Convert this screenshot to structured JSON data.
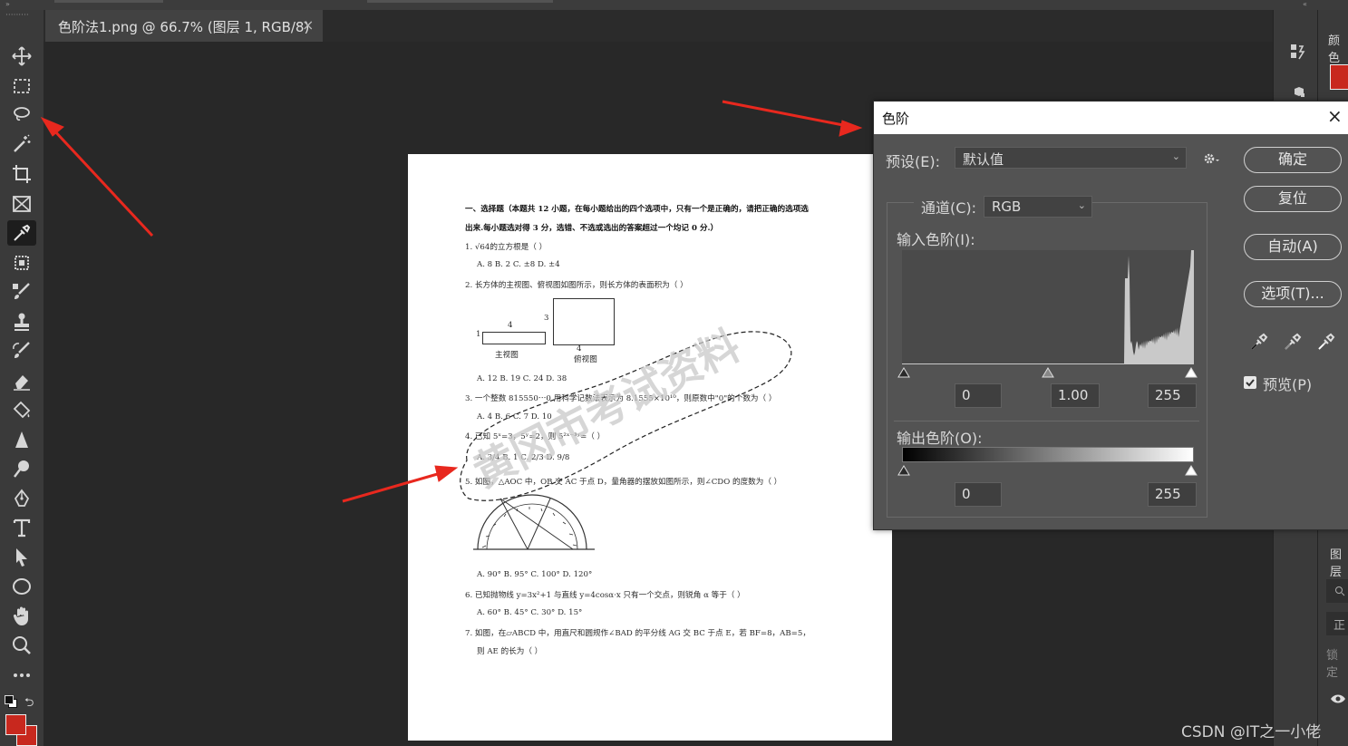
{
  "document_tab": {
    "title": "色阶法1.png @ 66.7% (图层 1, RGB/8)",
    "close": "×"
  },
  "levels_dialog": {
    "title": "色阶",
    "close": "×",
    "preset_label": "预设(E):",
    "preset_value": "默认值",
    "channel_label": "通道(C):",
    "channel_value": "RGB",
    "input_levels_label": "输入色阶(I):",
    "input_black": "0",
    "input_gamma": "1.00",
    "input_white": "255",
    "output_levels_label": "输出色阶(O):",
    "output_black": "0",
    "output_white": "255",
    "ok_label": "确定",
    "reset_label": "复位",
    "auto_label": "自动(A)",
    "options_label": "选项(T)...",
    "preview_label": "预览(P)",
    "preview_checked": true
  },
  "right_panel": {
    "color_tab": "颜色",
    "layers_tab": "图层",
    "normal": "正",
    "lock": "锁定"
  },
  "colors": {
    "foreground": "#c8281e",
    "background": "#c8281e",
    "arrow": "#e8281e"
  },
  "paper": {
    "lines": [
      "一、选择题（本题共 12 小题，在每小题给出的四个选项中，只有一个是正确的，请把正确的选项选",
      "出来.每小题选对得 3 分，选错、不选或选出的答案超过一个均记 0 分.）",
      "1.  √64的立方根是（      ）",
      "A.  8                         B.  2                        C.  ±8                        D.  ±4",
      "2.  长方体的主视图、俯视图如图所示，则长方体的表面积为（      ）",
      "A.  12                       B.  19                       C.  24                        D.  38",
      "3.  一个整数 815550⋯0 用科学记数法表示为 8.1555×10¹⁰，则原数中\"0\"的个数为（      ）",
      "A.  4                         B.  6                        C.  7                         D.  10",
      "4.  已知 5ˣ=3，5ʸ=2，则 5²ˣ⁻³ʸ=（      ）",
      "A.  3/4                      B.  1                        C.  2/3                       D.  9/8",
      "5.  如图，△AOC 中，OB 交 AC 于点 D，量角器的摆放如图所示，则∠CDO 的度数为（      ）",
      "A.  90°                      B.  95°                      C.  100°                      D.  120°",
      "6.  已知抛物线 y=3x²+1 与直线 y=4cosα·x 只有一个交点，则锐角 α 等于（      ）",
      "A.  60°                      B.  45°                      C.  30°                       D.  15°",
      "7.  如图，在▱ABCD 中，用直尺和圆规作∠BAD 的平分线 AG 交 BC 于点 E，若 BF=8，AB=5，",
      "则 AE 的长为（      ）"
    ],
    "fig_main_label": "主视图",
    "fig_top_label": "俯视图",
    "fig_num_4a": "4",
    "fig_num_3": "3",
    "fig_num_1": "1",
    "fig_num_4b": "4",
    "watermark_text": "黄冈市考试资料"
  },
  "credit": "CSDN @IT之一小佬"
}
